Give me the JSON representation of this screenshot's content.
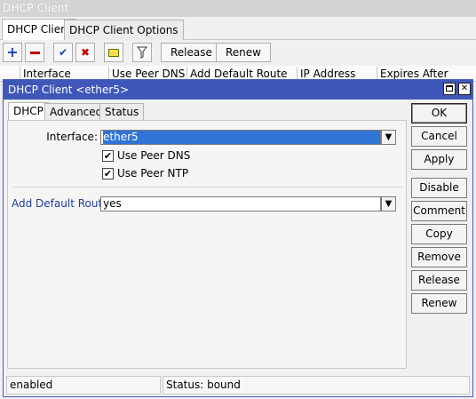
{
  "outer": {
    "title": "DHCP Client",
    "tabs": [
      "DHCP Client",
      "DHCP Client Options"
    ],
    "toolbar": {
      "release_label": "Release",
      "renew_label": "Renew"
    },
    "columns": [
      "Interface",
      "Use Peer DNS",
      "Add Default Route",
      "IP Address",
      "Expires After"
    ]
  },
  "dialog": {
    "title": "DHCP Client <ether5>",
    "tabs": [
      "DHCP",
      "Advanced",
      "Status"
    ],
    "form": {
      "interface_label": "Interface:",
      "interface_value": "ether5",
      "use_peer_dns_label": "Use Peer DNS",
      "use_peer_dns_checked": true,
      "use_peer_ntp_label": "Use Peer NTP",
      "use_peer_ntp_checked": true,
      "add_default_route_label": "Add Default Route:",
      "add_default_route_value": "yes"
    },
    "buttons": [
      "OK",
      "Cancel",
      "Apply",
      "Disable",
      "Comment",
      "Copy",
      "Remove",
      "Release",
      "Renew"
    ],
    "status": {
      "left": "enabled",
      "right": "Status: bound"
    }
  },
  "colors": {
    "dialog_title_bg": "#3f57b8",
    "label_blue": "#1f3d9c",
    "selection": "#3075d6"
  }
}
